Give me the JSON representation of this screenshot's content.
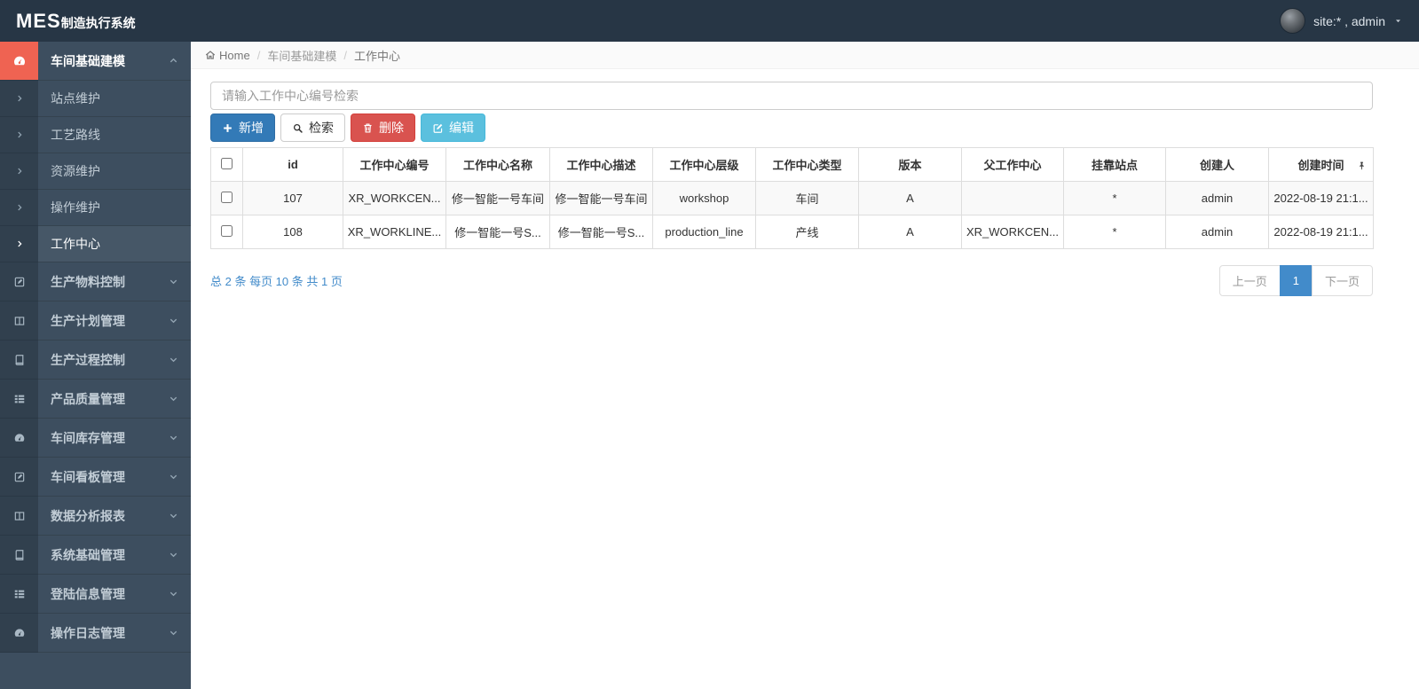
{
  "app": {
    "brand_main": "MES",
    "brand_suffix": "制造执行系统",
    "user_label": "site:* , admin"
  },
  "colors": {
    "navbar": "#273645",
    "sidebar": "#3d4e5f",
    "sidebar_icon_column": "#31404e",
    "accent_red": "#ef6352",
    "primary_blue": "#337ab7",
    "danger_red": "#d9534f",
    "info_blue": "#5bc0de",
    "link_blue": "#428bca"
  },
  "breadcrumb": {
    "home": "Home",
    "sep": "/",
    "crumb1": "车间基础建模",
    "crumb2": "工作中心"
  },
  "sidebar": {
    "active_group": {
      "label": "车间基础建模",
      "icon": "dashboard-icon"
    },
    "submenu": [
      {
        "label": "站点维护"
      },
      {
        "label": "工艺路线"
      },
      {
        "label": "资源维护"
      },
      {
        "label": "操作维护"
      },
      {
        "label": "工作中心",
        "active": true
      }
    ],
    "groups": [
      {
        "label": "生产物料控制",
        "icon": "edit-icon"
      },
      {
        "label": "生产计划管理",
        "icon": "columns-icon"
      },
      {
        "label": "生产过程控制",
        "icon": "book-icon"
      },
      {
        "label": "产品质量管理",
        "icon": "list-icon"
      },
      {
        "label": "车间库存管理",
        "icon": "dashboard-icon"
      },
      {
        "label": "车间看板管理",
        "icon": "edit-icon"
      },
      {
        "label": "数据分析报表",
        "icon": "columns-icon"
      },
      {
        "label": "系统基础管理",
        "icon": "book-icon"
      },
      {
        "label": "登陆信息管理",
        "icon": "list-icon"
      },
      {
        "label": "操作日志管理",
        "icon": "dashboard-icon"
      }
    ]
  },
  "search": {
    "placeholder": "请输入工作中心编号检索",
    "value": ""
  },
  "toolbar": {
    "add_label": "新增",
    "search_label": "检索",
    "delete_label": "删除",
    "edit_label": "编辑"
  },
  "table": {
    "headers": [
      "id",
      "工作中心编号",
      "工作中心名称",
      "工作中心描述",
      "工作中心层级",
      "工作中心类型",
      "版本",
      "父工作中心",
      "挂靠站点",
      "创建人",
      "创建时间"
    ],
    "rows": [
      {
        "cells": [
          "107",
          "XR_WORKCEN...",
          "修一智能一号车间",
          "修一智能一号车间",
          "workshop",
          "车间",
          "A",
          "",
          "*",
          "admin",
          "2022-08-19 21:1..."
        ]
      },
      {
        "cells": [
          "108",
          "XR_WORKLINE...",
          "修一智能一号S...",
          "修一智能一号S...",
          "production_line",
          "产线",
          "A",
          "XR_WORKCEN...",
          "*",
          "admin",
          "2022-08-19 21:1..."
        ]
      }
    ]
  },
  "pagination": {
    "summary": "总 2 条 每页 10 条 共 1 页",
    "prev": "上一页",
    "current": "1",
    "next": "下一页"
  }
}
